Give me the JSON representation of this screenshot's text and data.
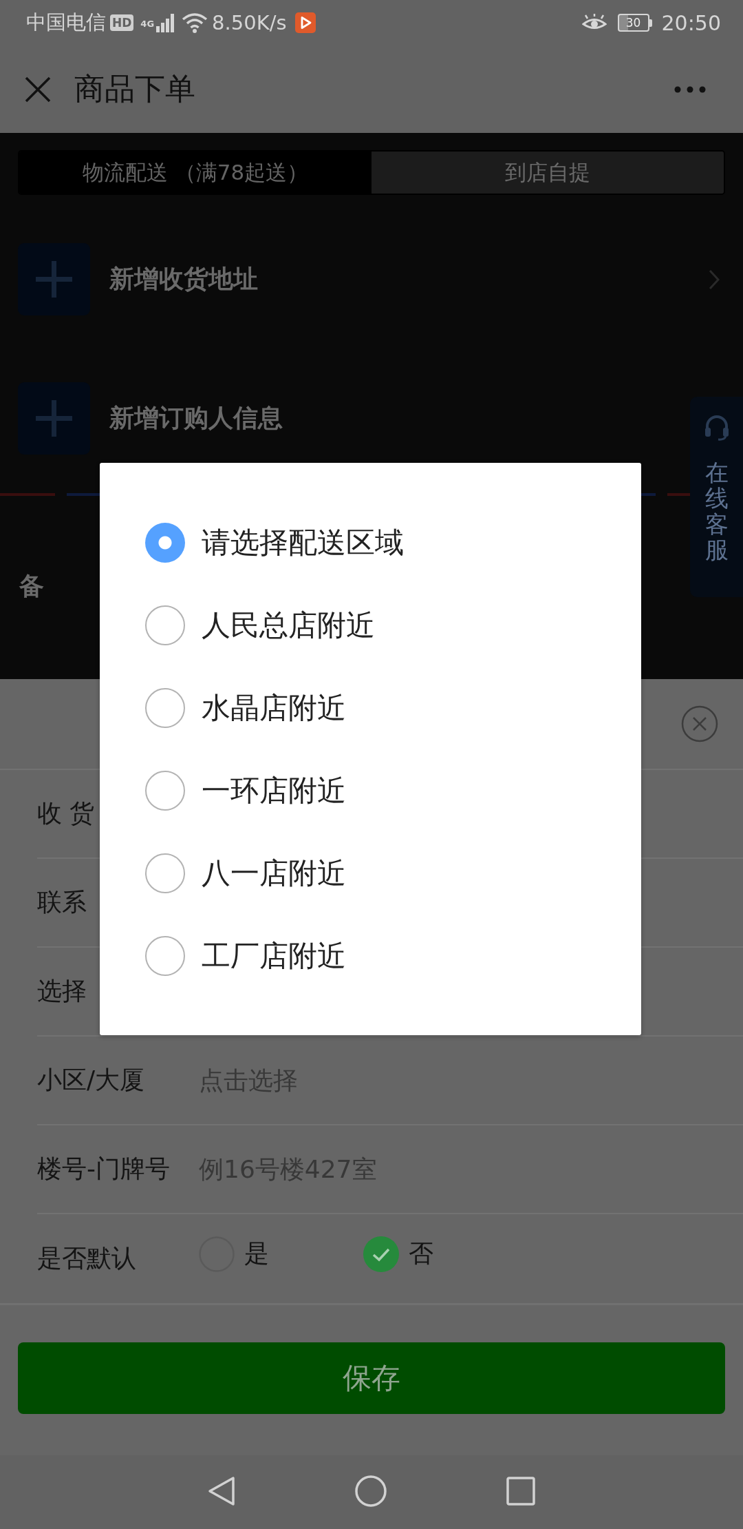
{
  "status_bar": {
    "carrier": "中国电信",
    "hd_badge": "HD",
    "network_type": "4G",
    "speed": "8.50K/s",
    "battery": "30",
    "time": "20:50"
  },
  "header": {
    "title": "商品下单"
  },
  "delivery_tabs": [
    {
      "label": "物流配送 （满78起送）",
      "selected": true
    },
    {
      "label": "到店自提",
      "selected": false
    }
  ],
  "actions": [
    {
      "label": "新增收货地址",
      "chevron": true
    },
    {
      "label": "新增订购人信息",
      "chevron": false
    }
  ],
  "remarks_label": "备",
  "support_button": {
    "label": "在线客服"
  },
  "address_sheet": {
    "fields": [
      {
        "kind": "input",
        "label": "收 货"
      },
      {
        "kind": "input",
        "label": "联系"
      },
      {
        "kind": "input",
        "label": "选择"
      },
      {
        "kind": "input",
        "label": "小区/大厦",
        "placeholder": "点击选择"
      },
      {
        "kind": "input",
        "label": "楼号-门牌号",
        "placeholder": "例16号楼427室"
      },
      {
        "kind": "choice",
        "label": "是否默认",
        "options": [
          {
            "label": "是",
            "selected": false
          },
          {
            "label": "否",
            "selected": true
          }
        ]
      }
    ],
    "save_button": "保存"
  },
  "area_dialog": {
    "options": [
      {
        "label": "请选择配送区域",
        "selected": true
      },
      {
        "label": "人民总店附近",
        "selected": false
      },
      {
        "label": "水晶店附近",
        "selected": false
      },
      {
        "label": "一环店附近",
        "selected": false
      },
      {
        "label": "八一店附近",
        "selected": false
      },
      {
        "label": "工厂店附近",
        "selected": false
      }
    ]
  }
}
